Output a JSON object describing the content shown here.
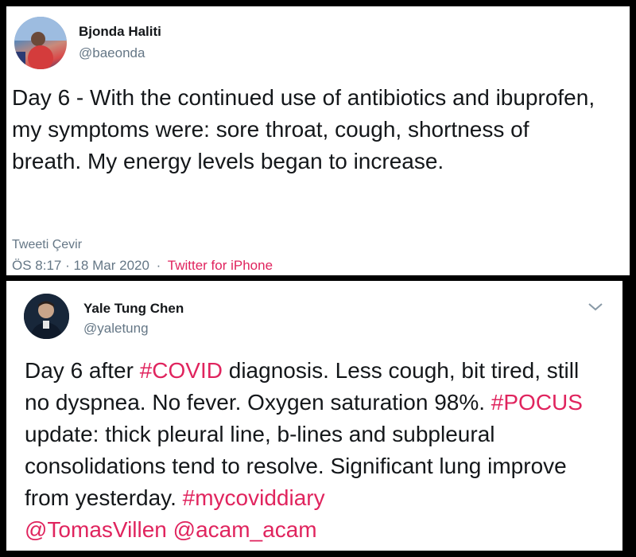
{
  "tweet1": {
    "author_name": "Bjonda Haliti",
    "author_handle": "@baeonda",
    "text": "Day 6 - With the continued use of antibiotics and ibuprofen, my symptoms were: sore throat, cough, shortness of breath. My energy levels began to increase.",
    "translate_label": "Tweeti Çevir",
    "timestamp": "ÖS 8:17 · 18 Mar 2020",
    "separator": "·",
    "source": "Twitter for iPhone"
  },
  "tweet2": {
    "author_name": "Yale Tung Chen",
    "author_handle": "@yaletung",
    "text_parts": {
      "p1": "Day 6 after ",
      "tag_covid": "#COVID",
      "p2": " diagnosis. Less cough, bit tired, still no dyspnea. No fever. Oxygen saturation 98%. ",
      "tag_pocus": "#POCUS",
      "p3": " update: thick pleural line, b-lines and subpleural consolidations tend to resolve. Significant lung improve from yesterday. ",
      "tag_diary": "#mycoviddiary",
      "mention1": "@TomasVillen",
      "space": " ",
      "mention2": "@acam_acam"
    }
  },
  "colors": {
    "link": "#e0245e",
    "secondary_text": "#657786",
    "primary_text": "#14171a"
  }
}
